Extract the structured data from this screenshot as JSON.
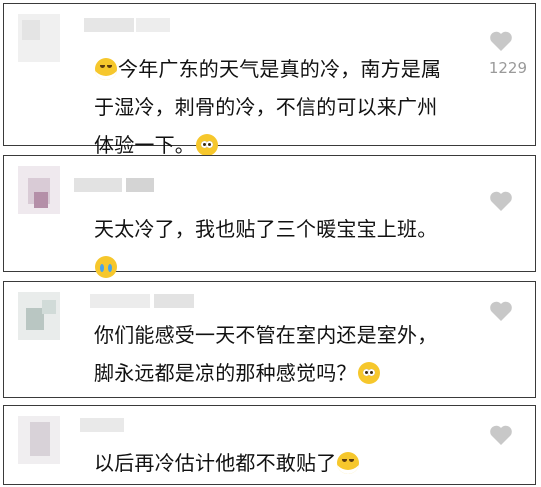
{
  "comments": [
    {
      "text": "今年广东的天气是真的冷，南方是属于湿冷，刺骨的冷，不信的可以来广州体验一下。",
      "likes": "1229",
      "emojis": [
        "laugh-cry-emoji",
        "pleading-emoji"
      ]
    },
    {
      "text": "天太冷了，我也贴了三个暖宝宝上班。",
      "likes": "",
      "emojis": [
        "crying-emoji"
      ]
    },
    {
      "text": "你们能感受一天不管在室内还是室外，脚永远都是凉的那种感觉吗？",
      "likes": "",
      "emojis": [
        "pleading-emoji"
      ]
    },
    {
      "text": "以后再冷估计他都不敢贴了",
      "likes": "",
      "emojis": [
        "laugh-cry-emoji"
      ]
    }
  ],
  "colors": {
    "border": "#3a3a3a",
    "text": "#111111",
    "like_icon": "#c8c8c8",
    "like_count": "#9a9a9a",
    "emoji_face": "#f6c72c"
  },
  "icons": {
    "like": "heart-icon"
  }
}
